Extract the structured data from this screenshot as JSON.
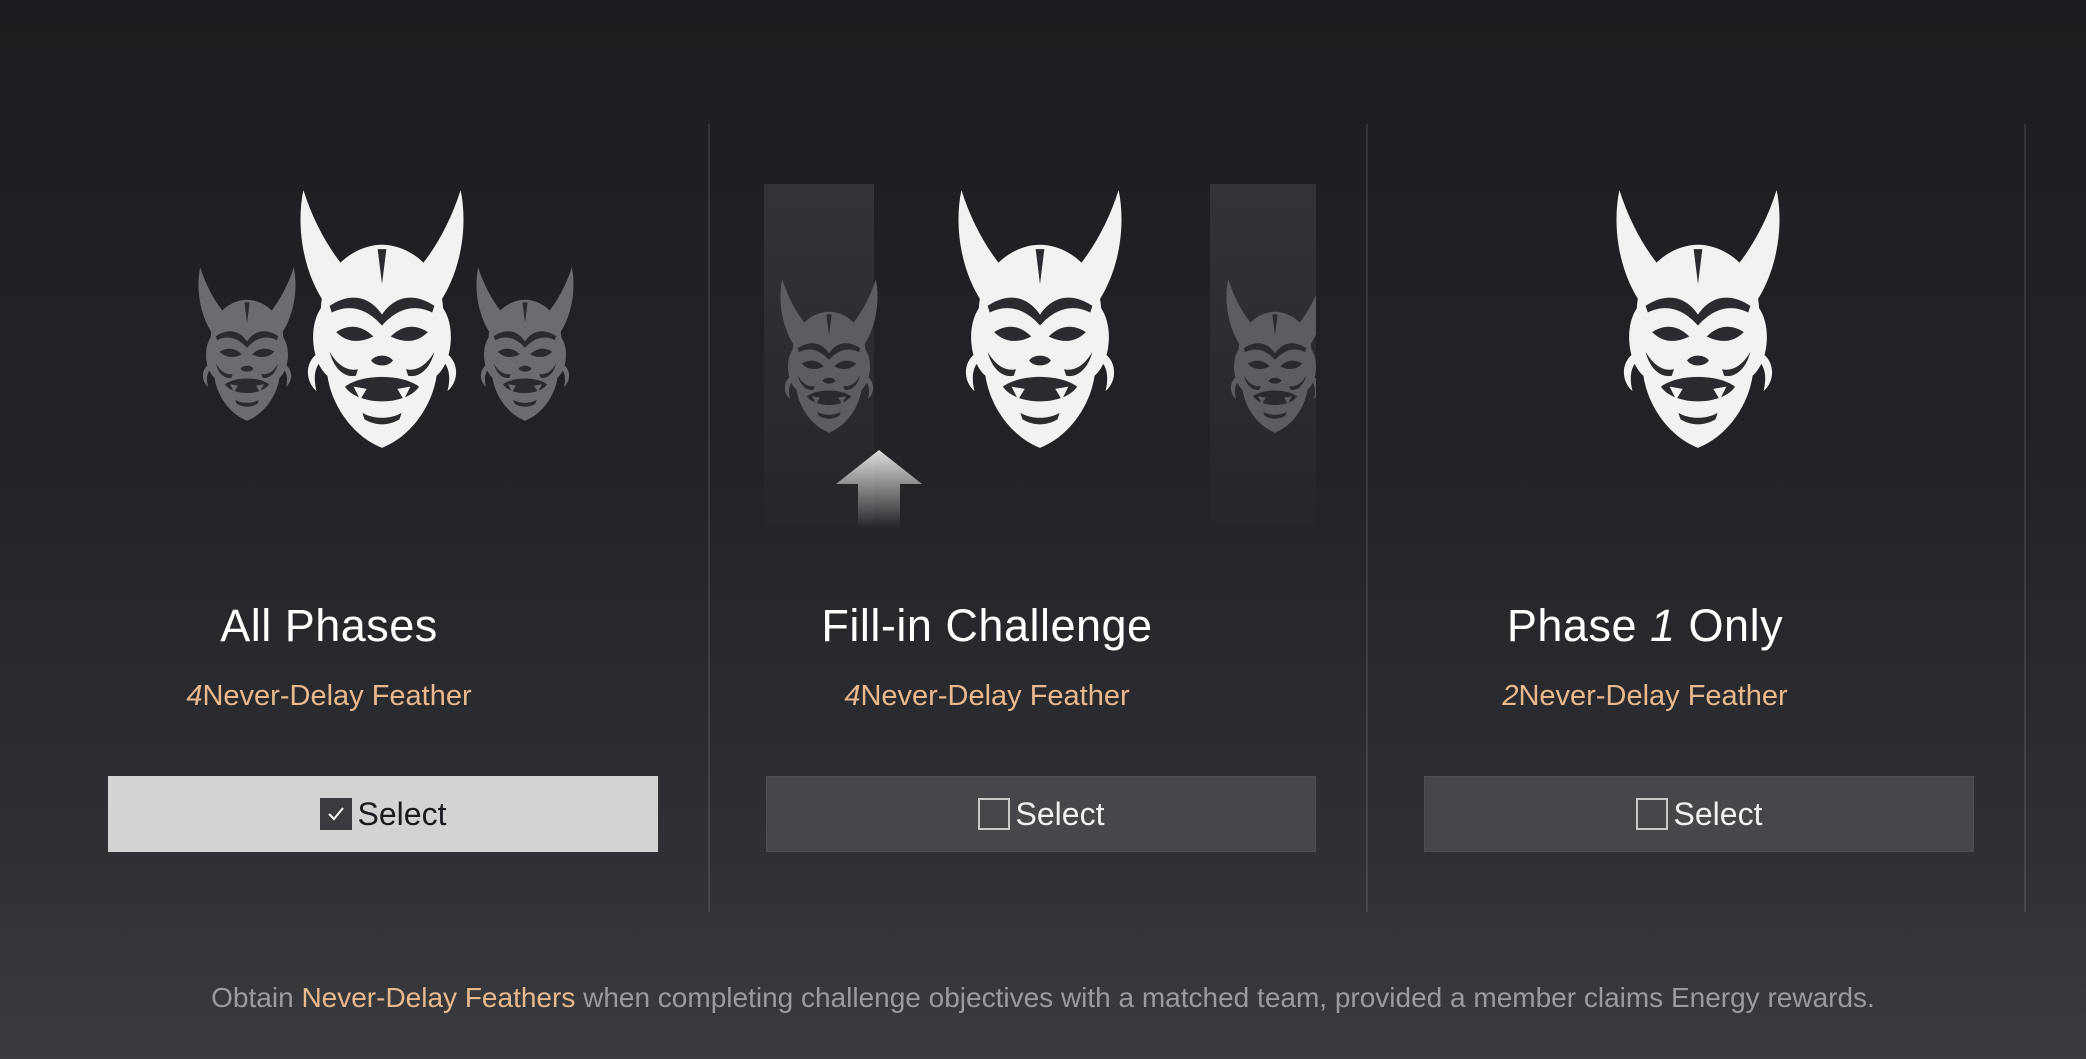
{
  "screen": {
    "footer": {
      "prefix": "Obtain ",
      "highlight": "Never-Delay Feathers",
      "suffix": " when completing challenge objectives with a matched team, provided a member claims Energy rewards."
    }
  },
  "cards": [
    {
      "title_text": "All Phases",
      "reward_qty": "4",
      "reward_label": "Never-Delay Feather",
      "select_label": "Select",
      "selected": true,
      "icon": "triple-oni-mask-icon"
    },
    {
      "title_text": "Fill-in Challenge",
      "reward_qty": "4",
      "reward_label": "Never-Delay Feather",
      "select_label": "Select",
      "selected": false,
      "icon": "oni-mask-with-arrow-icon"
    },
    {
      "title_prefix": "Phase ",
      "title_num": "1",
      "title_suffix": " Only",
      "reward_qty": "2",
      "reward_label": "Never-Delay Feather",
      "select_label": "Select",
      "selected": false,
      "icon": "single-oni-mask-icon"
    }
  ],
  "colors": {
    "accent": "#e8b98e",
    "button_active": "#d3d3d3",
    "button_inactive": "#45474b",
    "text_muted": "#9a9b9e"
  }
}
